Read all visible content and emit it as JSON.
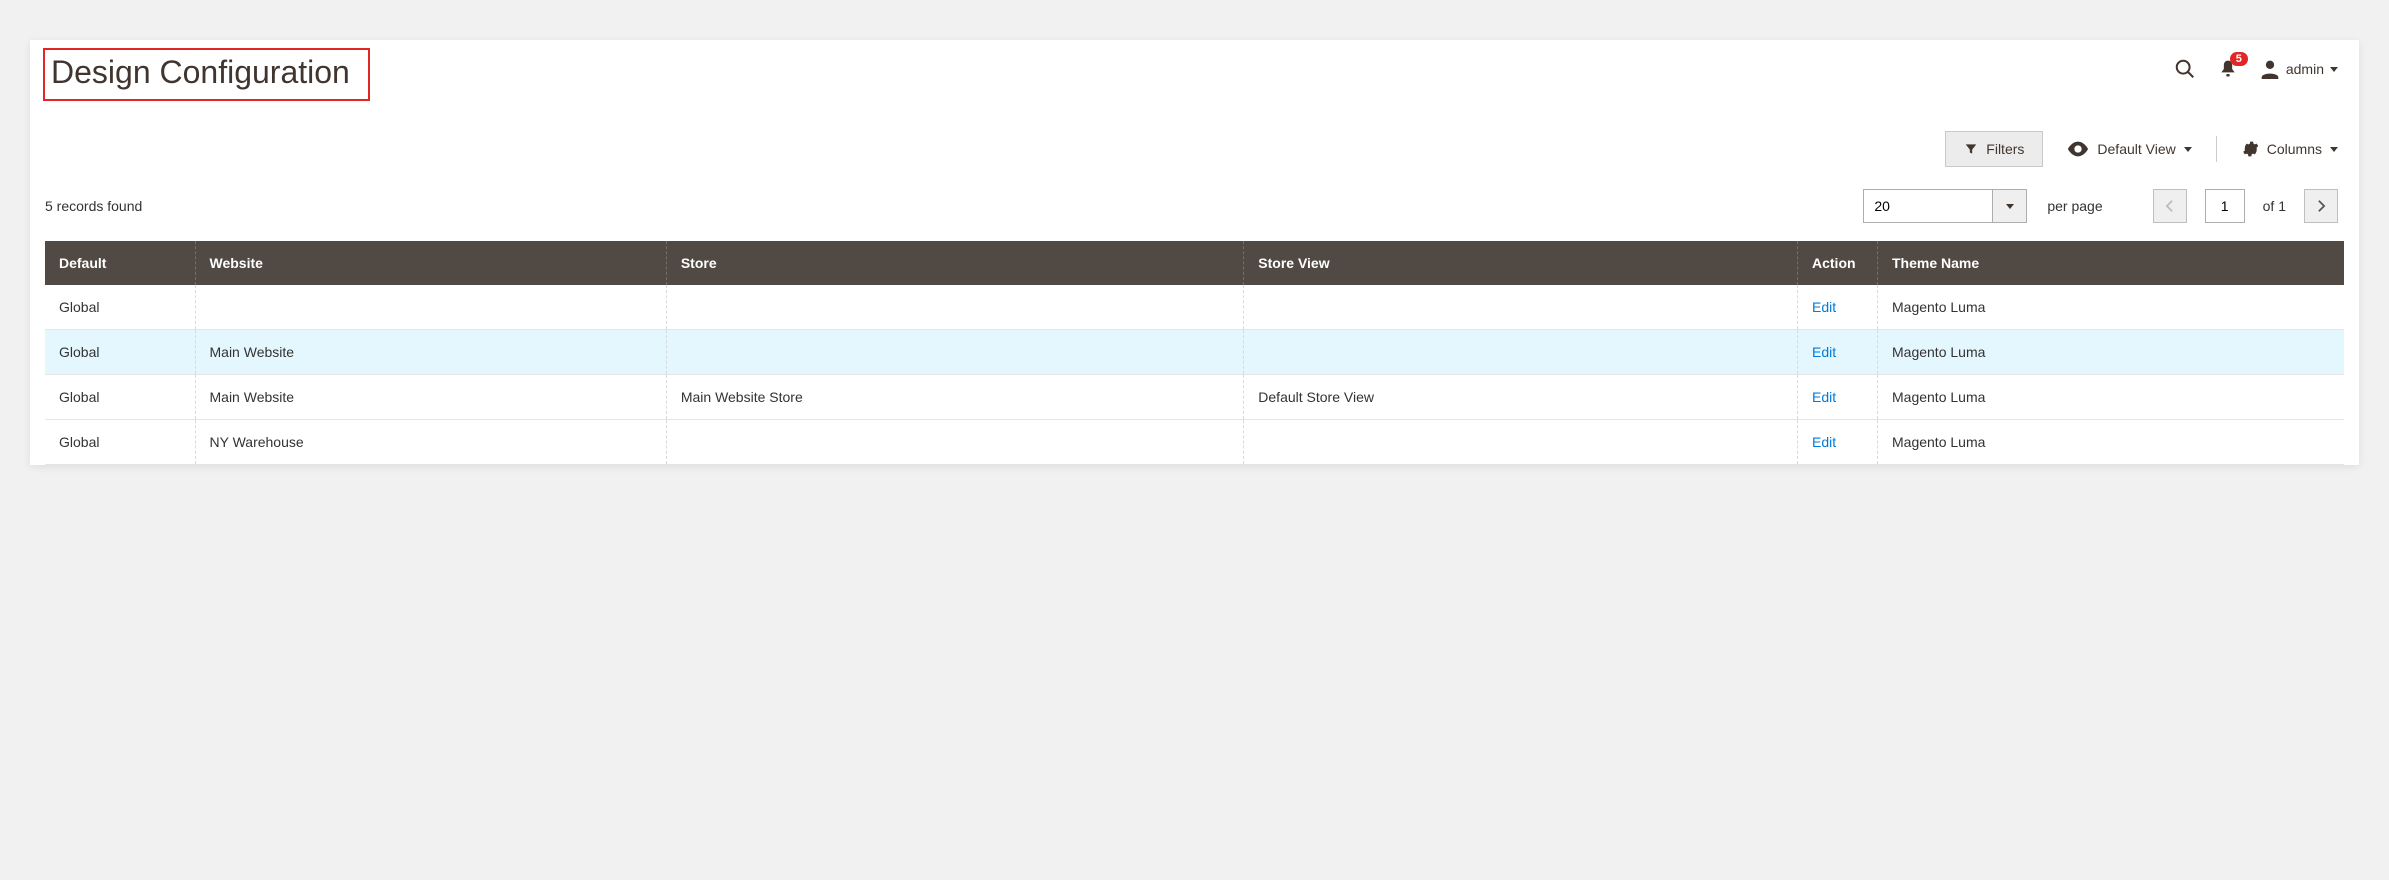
{
  "page": {
    "title": "Design Configuration"
  },
  "header": {
    "notification_count": "5",
    "user_label": "admin"
  },
  "toolbar": {
    "filters_label": "Filters",
    "default_view_label": "Default View",
    "columns_label": "Columns"
  },
  "records": {
    "found_text": "5 records found",
    "page_size": "20",
    "per_page_label": "per page",
    "current_page": "1",
    "of_label": "of 1"
  },
  "grid": {
    "columns": {
      "default": "Default",
      "website": "Website",
      "store": "Store",
      "store_view": "Store View",
      "action": "Action",
      "theme_name": "Theme Name"
    },
    "action_label": "Edit",
    "rows": [
      {
        "default": "Global",
        "website": "",
        "store": "",
        "store_view": "",
        "theme": "Magento Luma"
      },
      {
        "default": "Global",
        "website": "Main Website",
        "store": "",
        "store_view": "",
        "theme": "Magento Luma"
      },
      {
        "default": "Global",
        "website": "Main Website",
        "store": "Main Website Store",
        "store_view": "Default Store View",
        "theme": "Magento Luma"
      },
      {
        "default": "Global",
        "website": "NY Warehouse",
        "store": "",
        "store_view": "",
        "theme": "Magento Luma"
      }
    ]
  }
}
